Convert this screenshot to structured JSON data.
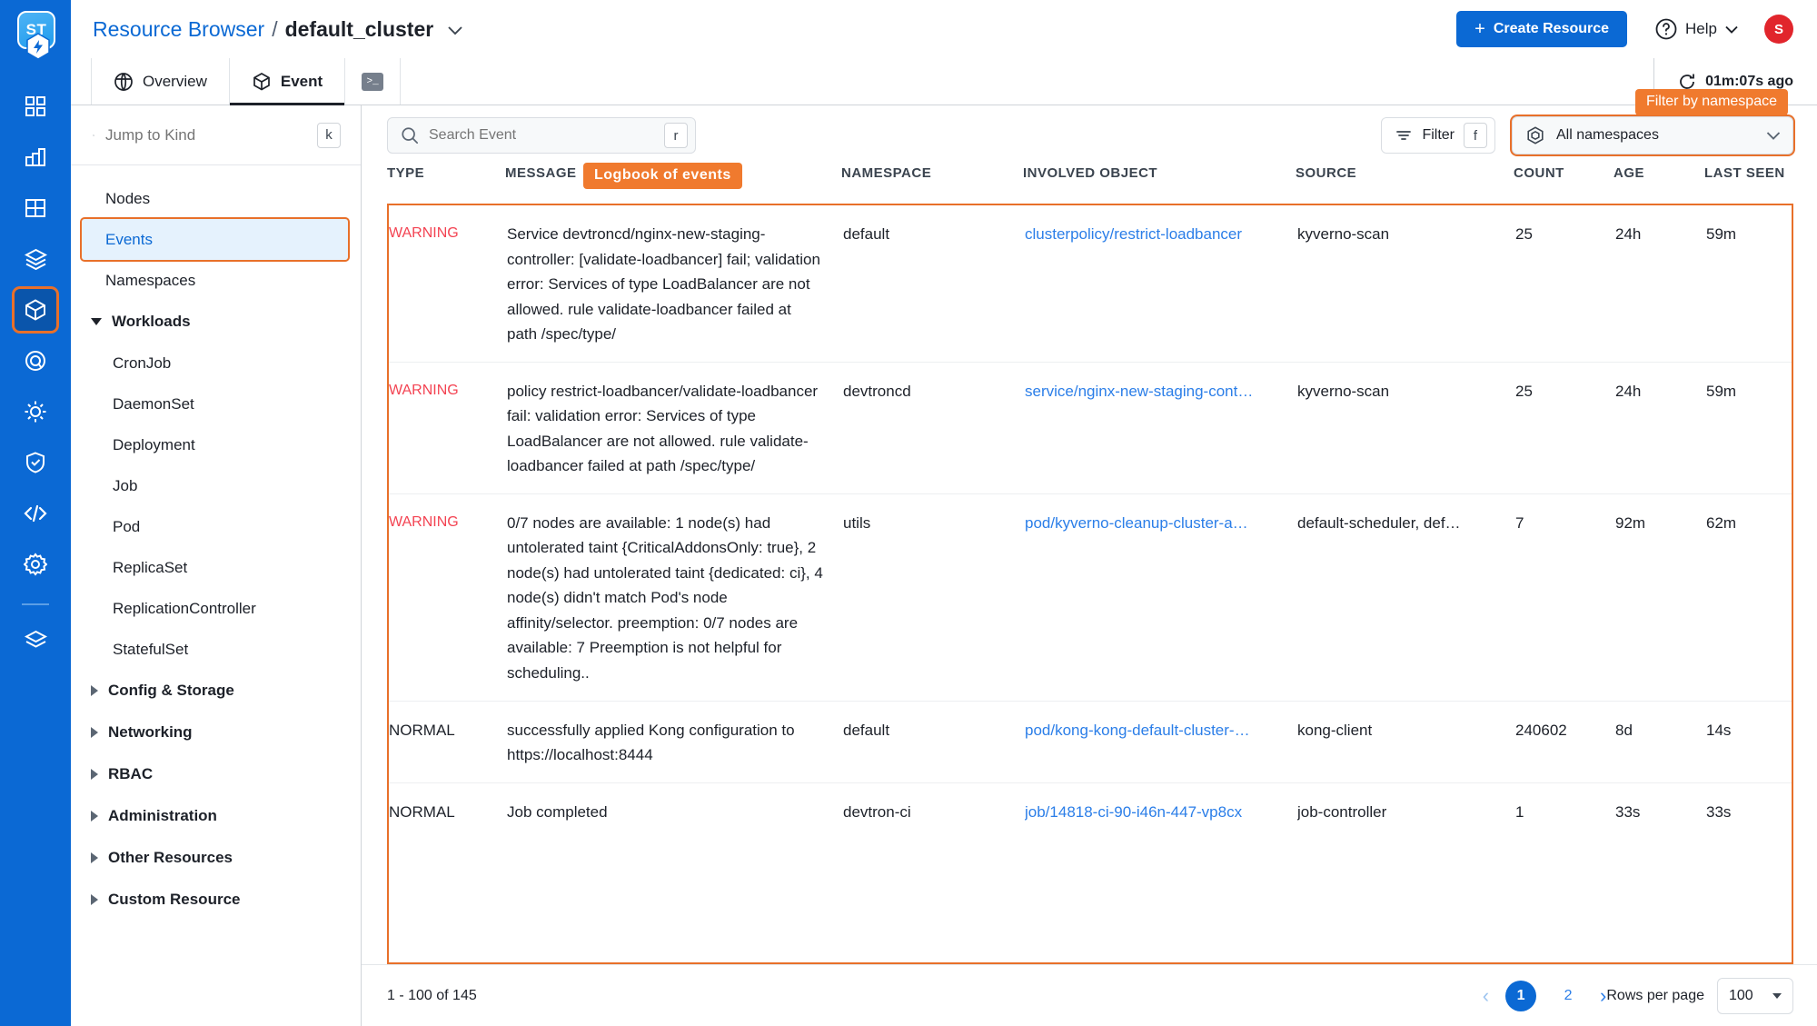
{
  "brand": {
    "logo_text": "ST",
    "accent": "#0b69d4",
    "callout_color": "#f07a2e"
  },
  "topbar": {
    "breadcrumb_root": "Resource Browser",
    "breadcrumb_sep": "/",
    "breadcrumb_current": "default_cluster",
    "create_plus": "+",
    "create_label": "Create Resource",
    "help_label": "Help",
    "avatar_initial": "S"
  },
  "tabs": [
    {
      "label": "Overview",
      "icon": "globe-icon",
      "active": false
    },
    {
      "label": "Event",
      "icon": "cube-icon",
      "active": true
    },
    {
      "label": "",
      "icon": "terminal-icon",
      "active": false
    }
  ],
  "refresh": {
    "label": "01m:07s ago",
    "icon": "refresh-icon"
  },
  "sidebar": {
    "search_placeholder": "Jump to Kind",
    "search_value": "",
    "search_kbd": "k",
    "top_items": [
      {
        "label": "Nodes",
        "selected": false
      },
      {
        "label": "Events",
        "selected": true
      },
      {
        "label": "Namespaces",
        "selected": false
      }
    ],
    "groups": [
      {
        "label": "Workloads",
        "expanded": true,
        "children": [
          "CronJob",
          "DaemonSet",
          "Deployment",
          "Job",
          "Pod",
          "ReplicaSet",
          "ReplicationController",
          "StatefulSet"
        ]
      },
      {
        "label": "Config & Storage",
        "expanded": false,
        "children": []
      },
      {
        "label": "Networking",
        "expanded": false,
        "children": []
      },
      {
        "label": "RBAC",
        "expanded": false,
        "children": []
      },
      {
        "label": "Administration",
        "expanded": false,
        "children": []
      },
      {
        "label": "Other Resources",
        "expanded": false,
        "children": []
      },
      {
        "label": "Custom Resource",
        "expanded": false,
        "children": []
      }
    ]
  },
  "toolbar": {
    "search_placeholder": "Search Event",
    "search_value": "",
    "search_kbd": "r",
    "filter_label": "Filter",
    "filter_kbd": "f",
    "namespace_value": "All namespaces",
    "namespace_callout": "Filter by namespace",
    "logbook_callout": "Logbook of events"
  },
  "table": {
    "columns": [
      "TYPE",
      "MESSAGE",
      "NAMESPACE",
      "INVOLVED OBJECT",
      "SOURCE",
      "COUNT",
      "AGE",
      "LAST SEEN"
    ],
    "rows": [
      {
        "type": "WARNING",
        "message": "Service devtroncd/nginx-new-staging-controller: [validate-loadbancer] fail; validation error: Services of type LoadBalancer are not allowed. rule validate-loadbancer failed at path /spec/type/",
        "namespace": "default",
        "involved_object": "clusterpolicy/restrict-loadbancer",
        "source": "kyverno-scan",
        "count": "25",
        "age": "24h",
        "last_seen": "59m"
      },
      {
        "type": "WARNING",
        "message": "policy restrict-loadbancer/validate-loadbancer fail: validation error: Services of type LoadBalancer are not allowed. rule validate-loadbancer failed at path /spec/type/",
        "namespace": "devtroncd",
        "involved_object": "service/nginx-new-staging-cont…",
        "source": "kyverno-scan",
        "count": "25",
        "age": "24h",
        "last_seen": "59m"
      },
      {
        "type": "WARNING",
        "message": "0/7 nodes are available: 1 node(s) had untolerated taint {CriticalAddonsOnly: true}, 2 node(s) had untolerated taint {dedicated: ci}, 4 node(s) didn't match Pod's node affinity/selector. preemption: 0/7 nodes are available: 7 Preemption is not helpful for scheduling..",
        "namespace": "utils",
        "involved_object": "pod/kyverno-cleanup-cluster-a…",
        "source": "default-scheduler, def…",
        "count": "7",
        "age": "92m",
        "last_seen": "62m"
      },
      {
        "type": "NORMAL",
        "message": "successfully applied Kong configuration to https://localhost:8444",
        "namespace": "default",
        "involved_object": "pod/kong-kong-default-cluster-…",
        "source": "kong-client",
        "count": "240602",
        "age": "8d",
        "last_seen": "14s"
      },
      {
        "type": "NORMAL",
        "message": "Job completed",
        "namespace": "devtron-ci",
        "involved_object": "job/14818-ci-90-i46n-447-vp8cx",
        "source": "job-controller",
        "count": "1",
        "age": "33s",
        "last_seen": "33s"
      }
    ]
  },
  "footer": {
    "range_text": "1 - 100 of 145",
    "prev_glyph": "‹",
    "next_glyph": "›",
    "pages": [
      "1",
      "2"
    ],
    "active_page": "1",
    "rows_per_page_label": "Rows per page",
    "rows_per_page_value": "100"
  }
}
